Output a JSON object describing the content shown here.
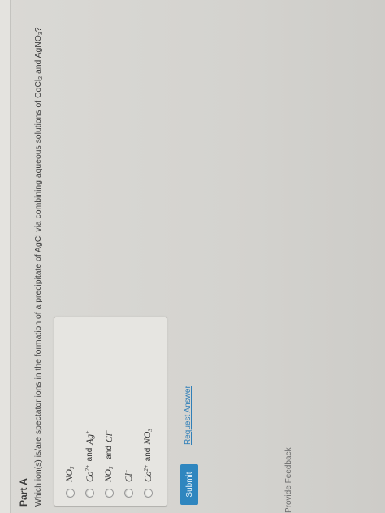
{
  "part": {
    "title": "Part A"
  },
  "question": {
    "prefix": "Which ion(s) is/are spectator ions in the formation of a precipitate of AgCl via combining aqueous solutions of CoCl",
    "sub1": "2",
    "middle": " and AgNO",
    "sub2": "3",
    "suffix": "?"
  },
  "options": [
    {
      "a": "NO",
      "a_sub": "3",
      "a_sup": "−",
      "joiner": "",
      "b": "",
      "b_sub": "",
      "b_sup": ""
    },
    {
      "a": "Co",
      "a_sub": "",
      "a_sup": "2+",
      "joiner": "and",
      "b": "Ag",
      "b_sub": "",
      "b_sup": "+"
    },
    {
      "a": "NO",
      "a_sub": "3",
      "a_sup": "−",
      "joiner": "and",
      "b": "Cl",
      "b_sub": "",
      "b_sup": "−"
    },
    {
      "a": "Cl",
      "a_sub": "",
      "a_sup": "−",
      "joiner": "",
      "b": "",
      "b_sub": "",
      "b_sup": ""
    },
    {
      "a": "Co",
      "a_sub": "",
      "a_sup": "2+",
      "joiner": "and",
      "b": "NO",
      "b_sub": "3",
      "b_sup": "−"
    }
  ],
  "actions": {
    "submit_label": "Submit",
    "request_answer_label": "Request Answer"
  },
  "footer": {
    "feedback_label": "Provide Feedback"
  },
  "colors": {
    "accent": "#2f86bf",
    "link": "#2f7fb8"
  }
}
